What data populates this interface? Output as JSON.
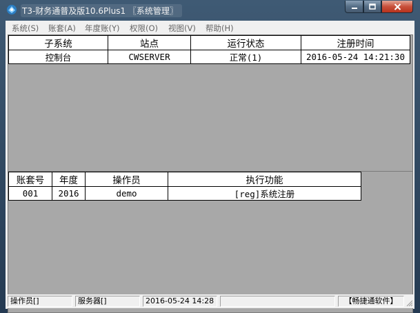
{
  "window": {
    "title": "T3-财务通普及版10.6Plus1 〖系统管理〗"
  },
  "menu": [
    {
      "label": "系统(S)"
    },
    {
      "label": "账套(A)"
    },
    {
      "label": "年度账(Y)"
    },
    {
      "label": "权限(O)"
    },
    {
      "label": "视图(V)"
    },
    {
      "label": "帮助(H)"
    }
  ],
  "subsystem_table": {
    "headers": [
      "子系统",
      "站点",
      "运行状态",
      "注册时间"
    ],
    "rows": [
      [
        "控制台",
        "CWSERVER",
        "正常(1)",
        "2016-05-24 14:21:30"
      ]
    ]
  },
  "task_table": {
    "headers": [
      "账套号",
      "年度",
      "操作员",
      "执行功能"
    ],
    "rows": [
      [
        "001",
        "2016",
        "demo",
        "[reg]系统注册"
      ]
    ]
  },
  "status_bar": {
    "operator": "操作员[]",
    "server": "服务器[]",
    "datetime": "2016-05-24 14:28",
    "brand": "【畅捷通软件】"
  },
  "colors": {
    "panel_bg": "#a8a8a8",
    "title_bar": "#2f4a66",
    "close_button": "#c8503b"
  }
}
